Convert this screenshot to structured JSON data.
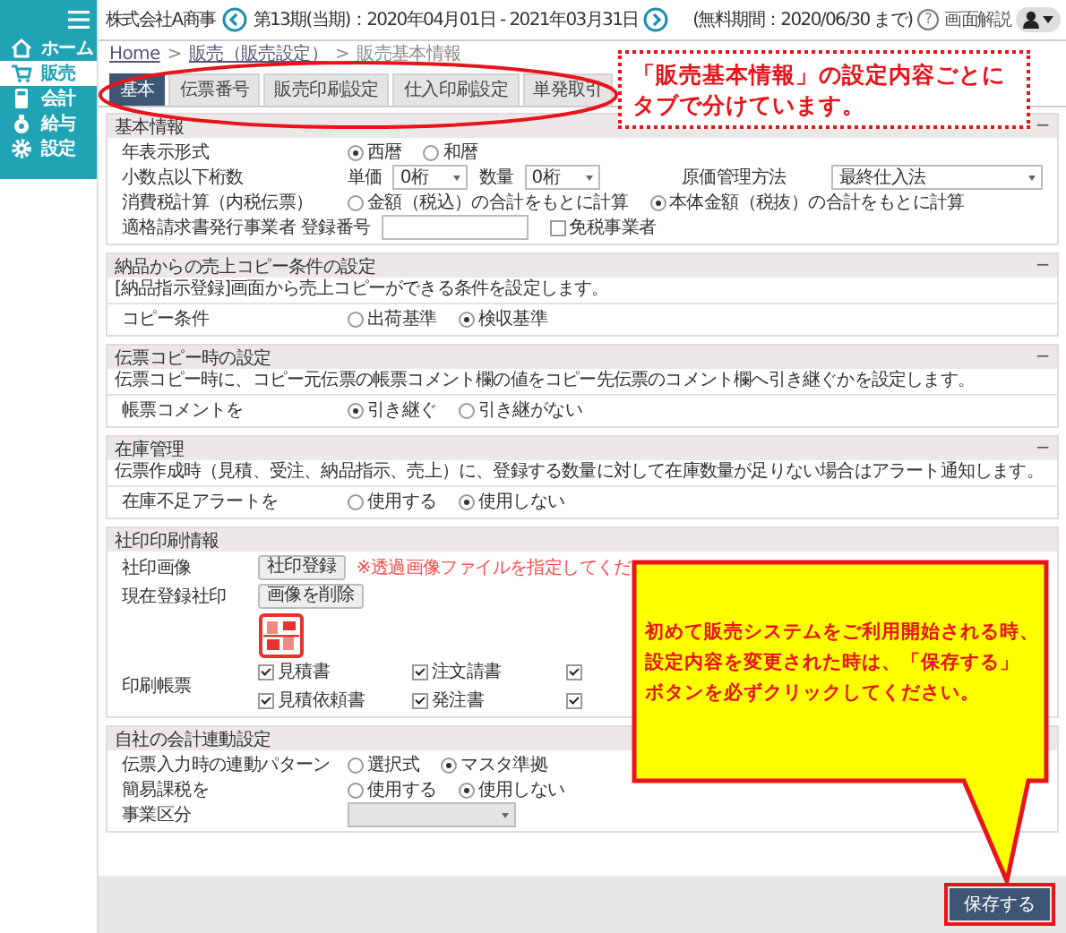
{
  "sidebar": {
    "items": [
      {
        "label": "ホーム",
        "kind": "home",
        "selected": false
      },
      {
        "label": "販売",
        "kind": "cart",
        "selected": true
      },
      {
        "label": "会計",
        "kind": "calculator",
        "selected": false
      },
      {
        "label": "給与",
        "kind": "bag",
        "selected": false
      },
      {
        "label": "設定",
        "kind": "gear",
        "selected": false
      }
    ]
  },
  "header": {
    "company": "株式会社A商事",
    "period": "第13期(当期)：2020年04月01日 - 2021年03月31日",
    "trial": "(無料期間：2020/06/30 まで)",
    "help_mark": "?",
    "help_label": "画面解説"
  },
  "breadcrumb": [
    {
      "kind": "link",
      "label": "Home"
    },
    {
      "kind": "sep",
      "label": ">"
    },
    {
      "kind": "link",
      "label": "販売（販売設定）"
    },
    {
      "kind": "sep",
      "label": ">"
    },
    {
      "kind": "current",
      "label": "販売基本情報"
    }
  ],
  "tabs": [
    {
      "label": "基本",
      "selected": true
    },
    {
      "label": "伝票番号",
      "selected": false
    },
    {
      "label": "販売印刷設定",
      "selected": false
    },
    {
      "label": "仕入印刷設定",
      "selected": false
    },
    {
      "label": "単発取引",
      "selected": false
    }
  ],
  "sections": [
    {
      "title": "基本情報",
      "collapse": "−",
      "rows": [
        {
          "kind": "radio",
          "label": "年表示形式",
          "options": [
            {
              "label": "西暦",
              "selected": true
            },
            {
              "label": "和暦",
              "selected": false
            }
          ]
        },
        {
          "kind": "decimals",
          "label": "小数点以下桁数",
          "selects": [
            {
              "label": "単価",
              "value": "0桁"
            },
            {
              "label": "数量",
              "value": "0桁"
            }
          ],
          "side_label": "原価管理方法",
          "side_value": "最終仕入法"
        },
        {
          "kind": "radio",
          "label": "消費税計算（内税伝票）",
          "options": [
            {
              "label": "金額（税込）の合計をもとに計算",
              "selected": false
            },
            {
              "label": "本体金額（税抜）の合計をもとに計算",
              "selected": true
            }
          ]
        },
        {
          "kind": "text_check",
          "label": "適格請求書発行事業者 登録番号",
          "check": {
            "label": "免税事業者",
            "checked": false
          }
        }
      ]
    },
    {
      "title": "納品からの売上コピー条件の設定",
      "collapse": "−",
      "description": "[納品指示登録]画面から売上コピーができる条件を設定します。",
      "rows": [
        {
          "kind": "radio",
          "label": "コピー条件",
          "options": [
            {
              "label": "出荷基準",
              "selected": false
            },
            {
              "label": "検収基準",
              "selected": true
            }
          ]
        }
      ]
    },
    {
      "title": "伝票コピー時の設定",
      "collapse": "−",
      "description": "伝票コピー時に、コピー元伝票の帳票コメント欄の値をコピー先伝票のコメント欄へ引き継ぐかを設定します。",
      "rows": [
        {
          "kind": "radio",
          "label": "帳票コメントを",
          "options": [
            {
              "label": "引き継ぐ",
              "selected": true
            },
            {
              "label": "引き継がない",
              "selected": false
            }
          ]
        }
      ]
    },
    {
      "title": "在庫管理",
      "collapse": "−",
      "description": "伝票作成時（見積、受注、納品指示、売上）に、登録する数量に対して在庫数量が足りない場合はアラート通知します。",
      "rows": [
        {
          "kind": "radio",
          "label": "在庫不足アラートを",
          "options": [
            {
              "label": "使用する",
              "selected": false
            },
            {
              "label": "使用しない",
              "selected": true
            }
          ]
        }
      ]
    },
    {
      "title": "社印印刷情報",
      "rows": [
        {
          "kind": "button_note",
          "label": "社印画像",
          "button": "社印登録",
          "note": "※透過画像ファイルを指定してくだ"
        },
        {
          "kind": "button",
          "label": "現在登録社印",
          "button": "画像を削除"
        },
        {
          "kind": "stamp"
        },
        {
          "kind": "checkgrid",
          "label": "印刷帳票",
          "items": [
            {
              "label": "見積書",
              "checked": true
            },
            {
              "label": "注文請書",
              "checked": true
            },
            {
              "checked": true
            },
            {
              "label": "見積依頼書",
              "checked": true
            },
            {
              "label": "発注書",
              "checked": true
            },
            {
              "checked": true
            }
          ]
        }
      ]
    },
    {
      "title": "自社の会計連動設定",
      "rows": [
        {
          "kind": "radio",
          "label": "伝票入力時の連動パターン",
          "options": [
            {
              "label": "選択式",
              "selected": false
            },
            {
              "label": "マスタ準拠",
              "selected": true
            }
          ]
        },
        {
          "kind": "radio",
          "label": "簡易課税を",
          "options": [
            {
              "label": "使用する",
              "selected": false
            },
            {
              "label": "使用しない",
              "selected": true
            }
          ]
        },
        {
          "kind": "select",
          "label": "事業区分",
          "disabled": true
        }
      ]
    }
  ],
  "footer": {
    "save": "保存する"
  },
  "annotations": {
    "tabs_note": [
      "「販売基本情報」の設定内容ごとに",
      "タブで分けています。"
    ],
    "save_note": [
      "初めて販売システムをご利用開始される時、",
      "設定内容を変更された時は、「保存する」",
      "ボタンを必ずクリックしてください。"
    ]
  }
}
